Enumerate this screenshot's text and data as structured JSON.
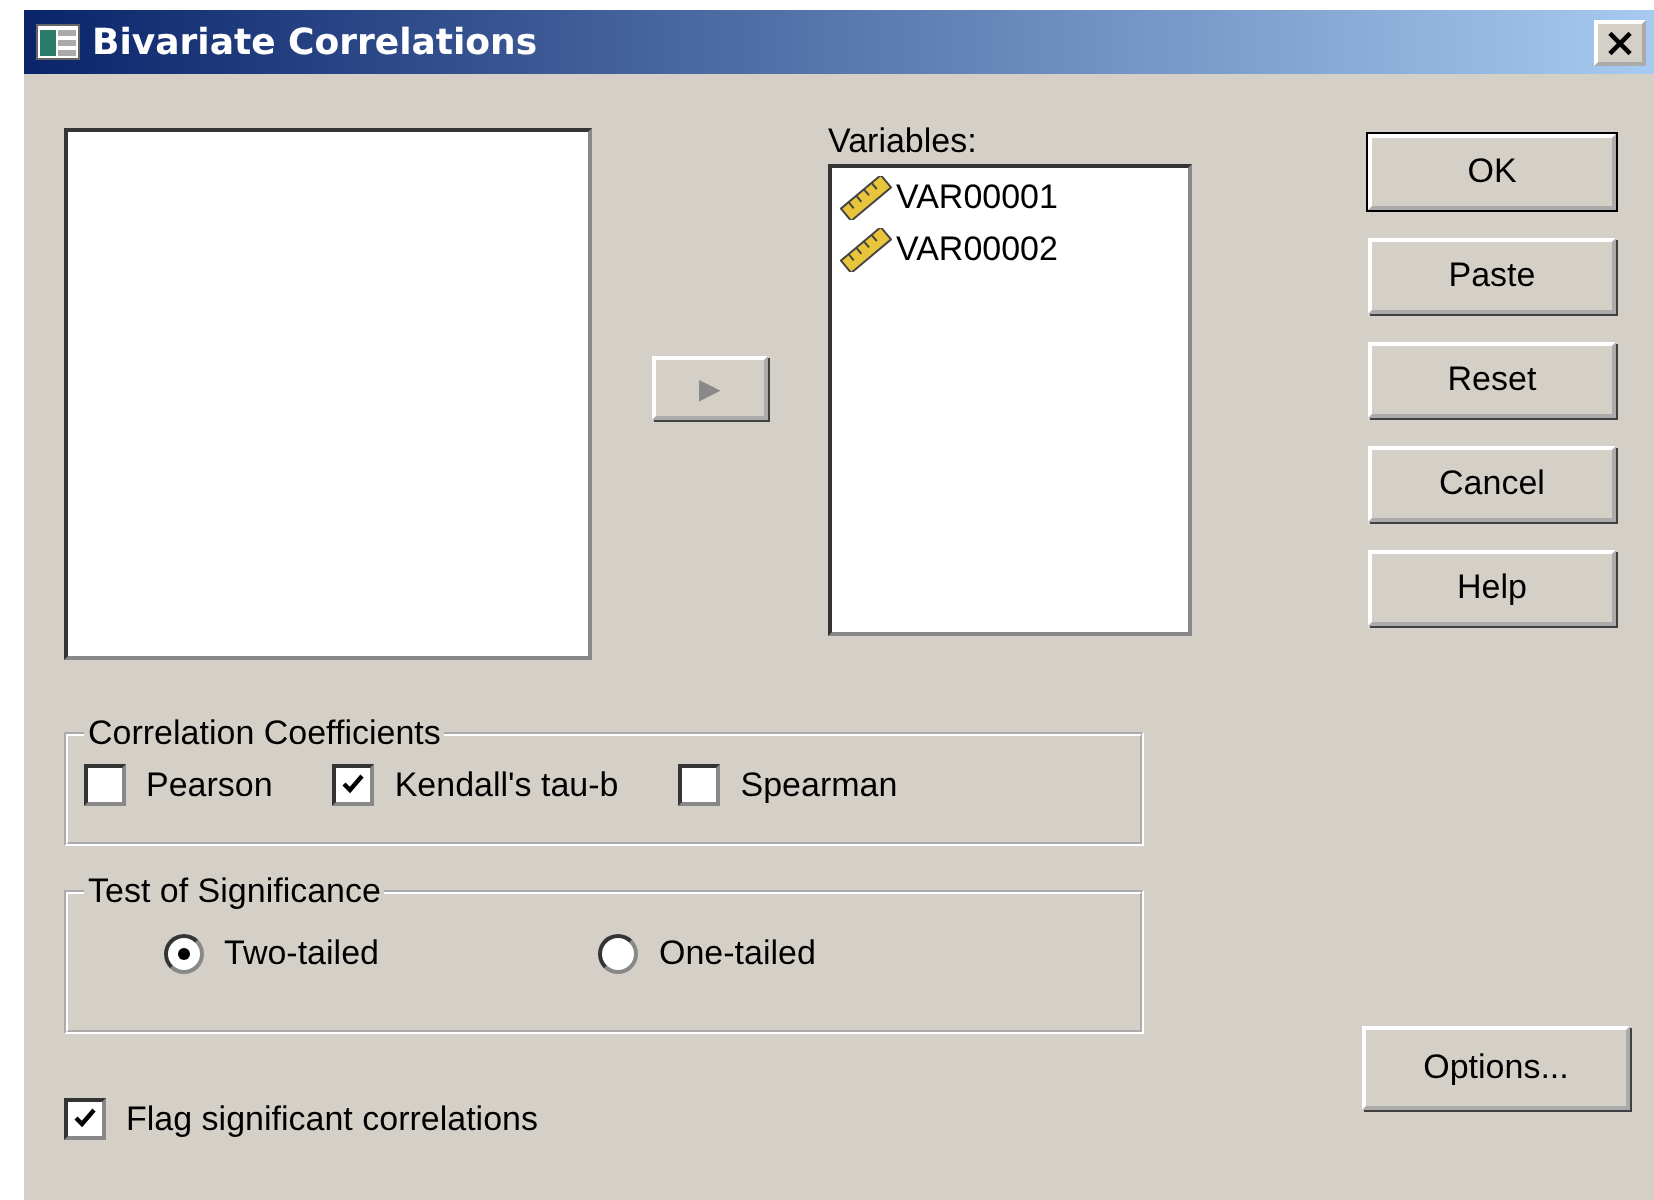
{
  "window": {
    "title": "Bivariate Correlations",
    "close": "×"
  },
  "move_button": {
    "label": "▶"
  },
  "variables": {
    "label": "Variables:",
    "items": [
      {
        "name": "VAR00001"
      },
      {
        "name": "VAR00002"
      }
    ]
  },
  "buttons": [
    {
      "label": "OK",
      "default": true
    },
    {
      "label": "Paste",
      "default": false
    },
    {
      "label": "Reset",
      "default": false
    },
    {
      "label": "Cancel",
      "default": false
    },
    {
      "label": "Help",
      "default": false
    }
  ],
  "correlation_coefficients": {
    "title": "Correlation Coefficients",
    "options": [
      {
        "label": "Pearson",
        "checked": false
      },
      {
        "label": "Kendall's tau-b",
        "checked": true
      },
      {
        "label": "Spearman",
        "checked": false
      }
    ]
  },
  "test_of_significance": {
    "title": "Test of Significance",
    "options": [
      {
        "label": "Two-tailed",
        "selected": true
      },
      {
        "label": "One-tailed",
        "selected": false
      }
    ]
  },
  "flag": {
    "label": "Flag significant correlations",
    "checked": true
  },
  "options_button": {
    "label": "Options..."
  }
}
